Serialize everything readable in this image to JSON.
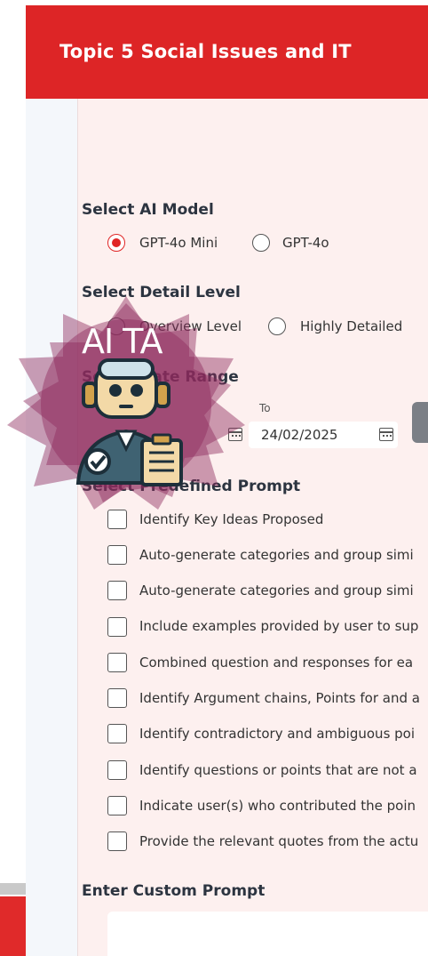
{
  "header": {
    "title": "Topic 5 Social Issues and IT"
  },
  "model": {
    "label": "Select AI Model",
    "options": [
      {
        "label": "GPT-4o Mini",
        "selected": true
      },
      {
        "label": "GPT-4o",
        "selected": false
      }
    ]
  },
  "detail": {
    "label": "Select Detail Level",
    "options": [
      {
        "label": "Overview Level",
        "selected": false
      },
      {
        "label": "Highly Detailed",
        "selected": false
      }
    ]
  },
  "date_range": {
    "label": "Select Date Range",
    "to_label": "To",
    "to_value": "24/02/2025"
  },
  "prompts": {
    "label": "Select Predefined Prompt",
    "items": [
      "Identify Key Ideas Proposed",
      "Auto-generate categories and group simi",
      "Auto-generate categories and group simi",
      "Include examples provided by user to sup",
      "Combined question and responses for ea",
      "Identify Argument chains, Points for and a",
      "Identify contradictory and ambiguous poi",
      "Identify questions or points that are not a",
      "Indicate user(s) who contributed the poin",
      "Provide the relevant quotes from the actu"
    ]
  },
  "custom": {
    "label": "Enter Custom Prompt"
  },
  "badge": {
    "label": "AI TA",
    "color": "#8e2a5e"
  },
  "colors": {
    "brand_red": "#dd2526",
    "panel_bg": "#fdf0ef",
    "radio_accent": "#e02626"
  }
}
